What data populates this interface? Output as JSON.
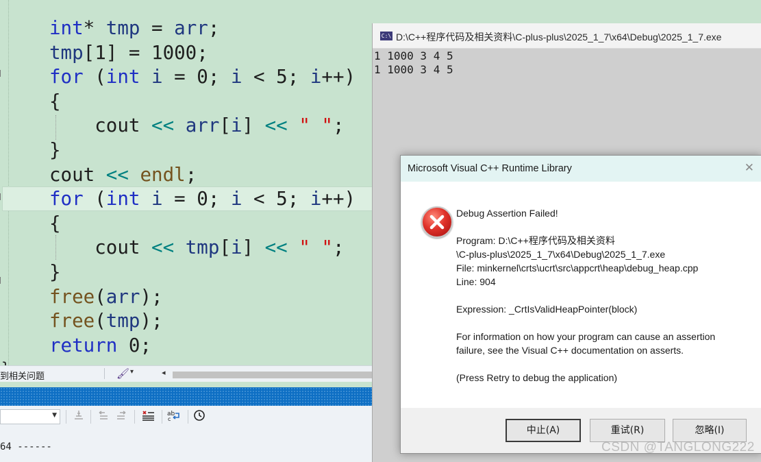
{
  "editor": {
    "lines": [
      [
        {
          "c": "ty",
          "t": "int"
        },
        {
          "c": "",
          "t": "* "
        },
        {
          "c": "id",
          "t": "tmp"
        },
        {
          "c": "",
          "t": " = "
        },
        {
          "c": "id",
          "t": "arr"
        },
        {
          "c": "",
          "t": ";"
        }
      ],
      [
        {
          "c": "id",
          "t": "tmp"
        },
        {
          "c": "",
          "t": "[1] = 1000;"
        }
      ],
      [
        {
          "c": "kw",
          "t": "for"
        },
        {
          "c": "",
          "t": " ("
        },
        {
          "c": "ty",
          "t": "int"
        },
        {
          "c": "",
          "t": " "
        },
        {
          "c": "id",
          "t": "i"
        },
        {
          "c": "",
          "t": " = 0; "
        },
        {
          "c": "id",
          "t": "i"
        },
        {
          "c": "",
          "t": " < 5; "
        },
        {
          "c": "id",
          "t": "i"
        },
        {
          "c": "",
          "t": "++)"
        }
      ],
      [
        {
          "c": "",
          "t": "{"
        }
      ],
      [
        {
          "c": "",
          "t": "    cout "
        },
        {
          "c": "op",
          "t": "<<"
        },
        {
          "c": "",
          "t": " "
        },
        {
          "c": "id",
          "t": "arr"
        },
        {
          "c": "",
          "t": "["
        },
        {
          "c": "id",
          "t": "i"
        },
        {
          "c": "",
          "t": "] "
        },
        {
          "c": "op",
          "t": "<<"
        },
        {
          "c": "",
          "t": " "
        },
        {
          "c": "st",
          "t": "\" \""
        },
        {
          "c": "",
          "t": ";"
        }
      ],
      [
        {
          "c": "",
          "t": "}"
        }
      ],
      [
        {
          "c": "",
          "t": "cout "
        },
        {
          "c": "op",
          "t": "<<"
        },
        {
          "c": "",
          "t": " "
        },
        {
          "c": "fn",
          "t": "endl"
        },
        {
          "c": "",
          "t": ";"
        }
      ],
      [
        {
          "c": "kw",
          "t": "for"
        },
        {
          "c": "",
          "t": " ("
        },
        {
          "c": "ty",
          "t": "int"
        },
        {
          "c": "",
          "t": " "
        },
        {
          "c": "id",
          "t": "i"
        },
        {
          "c": "",
          "t": " = 0; "
        },
        {
          "c": "id",
          "t": "i"
        },
        {
          "c": "",
          "t": " < 5; "
        },
        {
          "c": "id",
          "t": "i"
        },
        {
          "c": "",
          "t": "++)"
        }
      ],
      [
        {
          "c": "",
          "t": "{"
        }
      ],
      [
        {
          "c": "",
          "t": "    cout "
        },
        {
          "c": "op",
          "t": "<<"
        },
        {
          "c": "",
          "t": " "
        },
        {
          "c": "id",
          "t": "tmp"
        },
        {
          "c": "",
          "t": "["
        },
        {
          "c": "id",
          "t": "i"
        },
        {
          "c": "",
          "t": "] "
        },
        {
          "c": "op",
          "t": "<<"
        },
        {
          "c": "",
          "t": " "
        },
        {
          "c": "st",
          "t": "\" \""
        },
        {
          "c": "",
          "t": ";"
        }
      ],
      [
        {
          "c": "",
          "t": "}"
        }
      ],
      [
        {
          "c": "fn",
          "t": "free"
        },
        {
          "c": "",
          "t": "("
        },
        {
          "c": "id",
          "t": "arr"
        },
        {
          "c": "",
          "t": ");"
        }
      ],
      [
        {
          "c": "fn",
          "t": "free"
        },
        {
          "c": "",
          "t": "("
        },
        {
          "c": "id",
          "t": "tmp"
        },
        {
          "c": "",
          "t": ");"
        }
      ],
      [
        {
          "c": "kw",
          "t": "return"
        },
        {
          "c": "",
          "t": " 0;"
        }
      ]
    ],
    "closing_brace": "}"
  },
  "search_strip": {
    "text": "到相关问题",
    "brush_icon": "brush-icon",
    "dropdown_icon": "▾",
    "left_arrow_icon": "◂"
  },
  "output_panel": {
    "partial_line": "64 ------",
    "toolbar_icons": [
      "clear-icon",
      "prev-message-icon",
      "next-message-icon",
      "find-message-icon",
      "word-wrap-icon",
      "clock-icon"
    ]
  },
  "console": {
    "title": "D:\\C++程序代码及相关资料\\C-plus-plus\\2025_1_7\\x64\\Debug\\2025_1_7.exe",
    "icon_text": "C:\\",
    "output": [
      "1 1000 3 4 5",
      "1 1000 3 4 5"
    ]
  },
  "dialog": {
    "title": "Microsoft Visual C++ Runtime Library",
    "close": "✕",
    "heading": "Debug Assertion Failed!",
    "program_label": "Program: D:\\C++程序代码及相关资料",
    "program_path": "\\C-plus-plus\\2025_1_7\\x64\\Debug\\2025_1_7.exe",
    "file": "File: minkernel\\crts\\ucrt\\src\\appcrt\\heap\\debug_heap.cpp",
    "line": "Line: 904",
    "expression": "Expression: _CrtIsValidHeapPointer(block)",
    "info1": "For information on how your program can cause an assertion",
    "info2": "failure, see the Visual C++ documentation on asserts.",
    "press_retry": "(Press Retry to debug the application)",
    "buttons": {
      "abort": "中止(A)",
      "retry": "重试(R)",
      "ignore": "忽略(I)"
    }
  },
  "watermark": "CSDN @TANGLONG222",
  "colors": {
    "editor_bg": "#c8e3cf",
    "keyword": "#1f2fc4",
    "string": "#d01010",
    "status_bar": "#0e6fc4",
    "dialog_title_bg": "#e3f4f3"
  }
}
